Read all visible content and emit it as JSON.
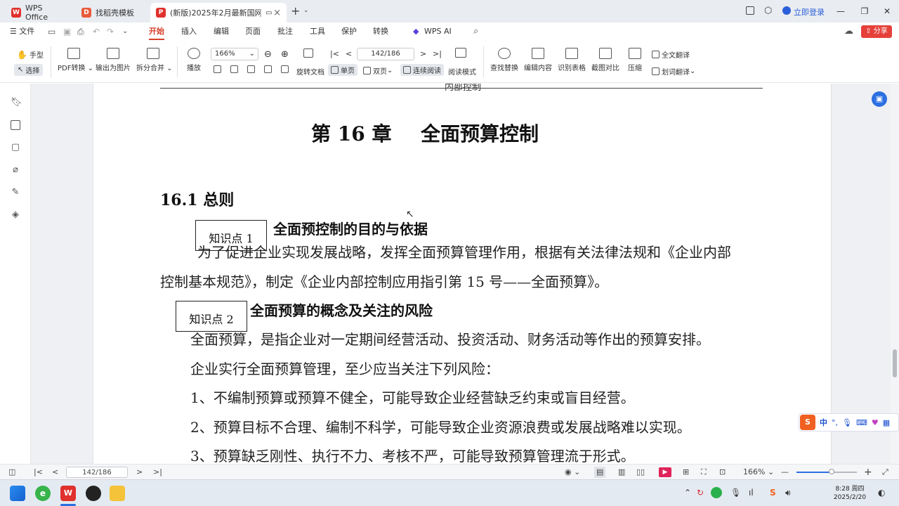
{
  "tabs": [
    {
      "label": "WPS Office"
    },
    {
      "label": "找稻壳模板"
    },
    {
      "label": "(新版)2025年2月最新国网"
    }
  ],
  "header_right": {
    "login": "立即登录"
  },
  "menu": {
    "file": "文件",
    "items": [
      "开始",
      "插入",
      "编辑",
      "页面",
      "批注",
      "工具",
      "保护",
      "转换"
    ],
    "wps_ai": "WPS AI",
    "share": "分享"
  },
  "ribbon": {
    "hand": "手型",
    "select": "选择",
    "pdf_convert": "PDF转换",
    "export_image": "输出为图片",
    "split_merge": "拆分合并",
    "play": "播放",
    "zoom": "166%",
    "page": "142/186",
    "rotate": "旋转文档",
    "single": "单页",
    "double": "双页",
    "continuous": "连续阅读",
    "read_mode": "阅读模式",
    "find_replace": "查找替换",
    "edit_content": "编辑内容",
    "recognize_table": "识别表格",
    "screenshot_compare": "截图对比",
    "compress": "压缩",
    "full_translate": "全文翻译",
    "word_translate": "划词翻译"
  },
  "doc": {
    "header_text": "内部控制",
    "chapter_num": "第 16 章",
    "chapter_title": "全面预算控制",
    "section": "16.1  总则",
    "k1_box": "知识点 1",
    "k1_title": "全面预控制的目的与依据",
    "p1_line1": "为了促进企业实现发展战略，发挥全面预算管理作用，根据有关法律法规和《企业内部",
    "p1_line2": "控制基本规范》，制定《企业内部控制应用指引第 15 号——全面预算》。",
    "k2_box": "知识点 2",
    "k2_title": "全面预算的概念及关注的风险",
    "p2": "全面预算，是指企业对一定期间经营活动、投资活动、财务活动等作出的预算安排。",
    "p3": "企业实行全面预算管理，至少应当关注下列风险：",
    "r1": "1、不编制预算或预算不健全，可能导致企业经营缺乏约束或盲目经营。",
    "r2": "2、预算目标不合理、编制不科学，可能导致企业资源浪费或发展战略难以实现。",
    "r3": "3、预算缺乏刚性、执行不力、考核不严，可能导致预算管理流于形式。"
  },
  "status": {
    "page": "142/186",
    "zoom": "166%"
  },
  "ime": {
    "label": "中"
  },
  "taskbar": {
    "time": "8:28 周四",
    "date": "2025/2/20"
  },
  "colors": {
    "accent": "#d7402a",
    "share_bg": "#e5413a",
    "login_blue": "#2b5fd9"
  }
}
